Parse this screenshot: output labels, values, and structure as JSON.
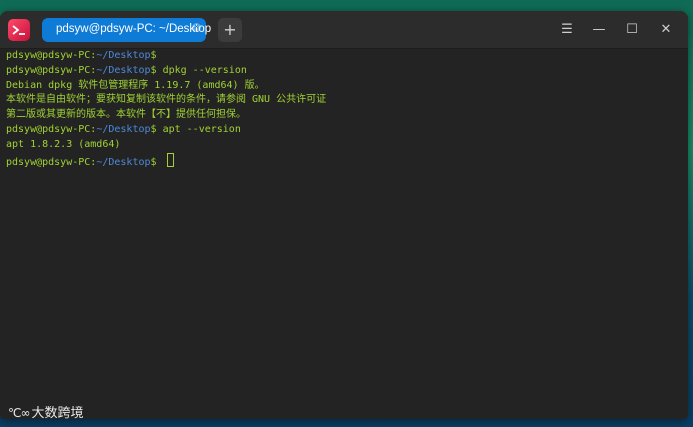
{
  "window": {
    "tab_label": "pdsyw@pdsyw-PC: ~/Desktop",
    "add_tab_symbol": "+",
    "controls": {
      "menu": "☰",
      "minimize": "—",
      "maximize": "☐",
      "close": "✕"
    }
  },
  "terminal": {
    "prompt_user": "pdsyw@pdsyw-PC",
    "prompt_sep": ":",
    "prompt_path": "~/Desktop",
    "prompt_symbol": "$",
    "lines": [
      {
        "type": "prompt",
        "cmd": ""
      },
      {
        "type": "prompt",
        "cmd": " dpkg --version"
      },
      {
        "type": "output",
        "text": "Debian dpkg 软件包管理程序 1.19.7 (amd64) 版。"
      },
      {
        "type": "output",
        "text": "本软件是自由软件；要获知复制该软件的条件，请参阅 GNU 公共许可证"
      },
      {
        "type": "output",
        "text": "第二版或其更新的版本。本软件【不】提供任何担保。"
      },
      {
        "type": "prompt",
        "cmd": " apt --version"
      },
      {
        "type": "output",
        "text": "apt 1.8.2.3 (amd64)"
      },
      {
        "type": "prompt",
        "cmd": " ",
        "cursor": true
      }
    ]
  },
  "watermark": {
    "logo": "℃∞",
    "text": "大数跨境"
  },
  "colors": {
    "prompt_green": "#a0d233",
    "path_blue": "#4e8ad9",
    "tab_blue": "#0e7bd7",
    "background": "#232323"
  }
}
